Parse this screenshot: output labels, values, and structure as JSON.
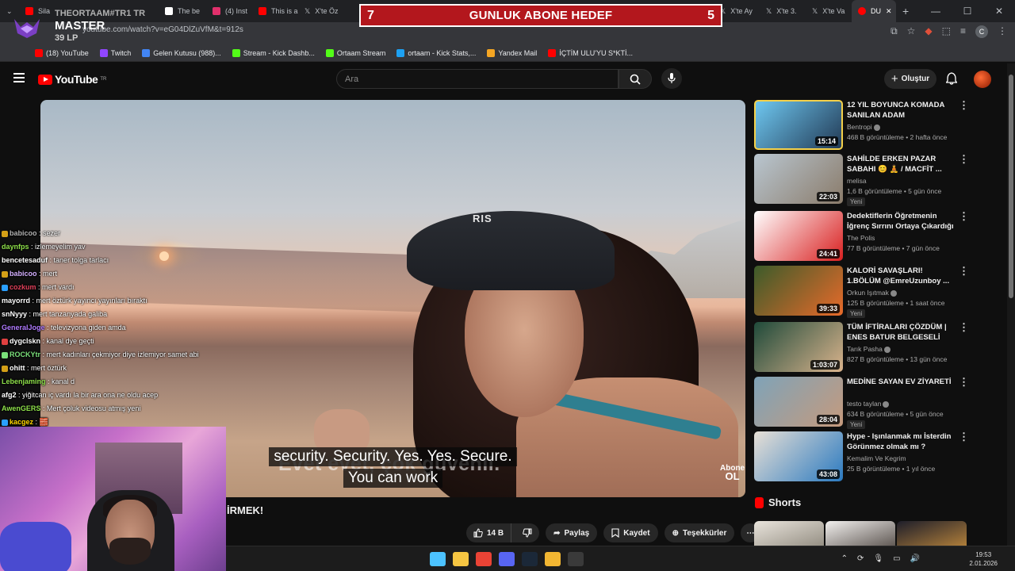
{
  "browser": {
    "tabs": [
      {
        "label": "Sila",
        "color": "#ff0000"
      },
      {
        "label": "THEORTAAM#TR1 TR",
        "color": "#9146ff"
      },
      {
        "label": "The be",
        "color": "#ffffff"
      },
      {
        "label": "(4) Inst",
        "color": "#e1306c"
      },
      {
        "label": "This is a",
        "color": "#ff0000"
      },
      {
        "label": "X'te Öz",
        "color": "#ffffff"
      },
      {
        "label": "X'te Ay",
        "color": "#ffffff"
      },
      {
        "label": "X'te 3.",
        "color": "#ffffff"
      },
      {
        "label": "X'te Va",
        "color": "#ffffff"
      },
      {
        "label": "DU",
        "color": "#ff0000"
      }
    ],
    "url": "youtube.com/watch?v=eG04DlZuVfM&t=912s",
    "profile_letter": "C",
    "bookmarks": [
      {
        "label": "(18) YouTube",
        "color": "#ff0000"
      },
      {
        "label": "Twitch",
        "color": "#9146ff"
      },
      {
        "label": "Gelen Kutusu (988)...",
        "color": "#4285f4"
      },
      {
        "label": "Stream - Kick Dashb...",
        "color": "#53fc18"
      },
      {
        "label": "Ortaam Stream",
        "color": "#53fc18"
      },
      {
        "label": "ortaam - Kick Stats,...",
        "color": "#1da1f2"
      },
      {
        "label": "Yandex Mail",
        "color": "#f5a623"
      },
      {
        "label": "İÇTİM ULU'YU S*KTİ...",
        "color": "#ff0000"
      }
    ]
  },
  "overlay": {
    "goal_left": "7",
    "goal_title": "GUNLUK ABONE HEDEF",
    "goal_right": "5",
    "rank_name": "THEORTAAM#TR1 TR",
    "rank_title": "MASTER",
    "rank_lp": "39 LP"
  },
  "youtube": {
    "logo_text": "YouTube",
    "logo_country": "TR",
    "search_placeholder": "Ara",
    "create_label": "Oluştur",
    "video": {
      "burned_subtitle": "Evet evet, çok güvenli.",
      "caption_line1": "security. Security. Yes. Yes. Secure.",
      "caption_line2": "You can work",
      "abone_top": "Abone",
      "abone_bottom": "OL",
      "title_fragment": "İRMEK!"
    },
    "actions": {
      "likes": "14 B",
      "share": "Paylaş",
      "save": "Kaydet",
      "thanks": "Teşekkürler"
    },
    "recommendations": [
      {
        "title": "12 YIL BOYUNCA KOMADA SANILAN ADAM",
        "channel": "Bentropi",
        "verified": true,
        "meta": "468 B görüntüleme • 2 hafta önce",
        "duration": "15:14",
        "badge": "",
        "colors": [
          "#6ec7f0",
          "#223a55"
        ]
      },
      {
        "title": "SAHİLDE ERKEN PAZAR SABAHI 😊 🧘 / MACFİT ...",
        "channel": "melisa",
        "verified": false,
        "meta": "1,6 B görüntüleme • 5 gün önce",
        "duration": "22:03",
        "badge": "Yeni",
        "colors": [
          "#b9c6d0",
          "#8a7b6a"
        ]
      },
      {
        "title": "Dedektiflerin Öğretmenin İğrenç Sırrını Ortaya Çıkardığı An",
        "channel": "The Polis",
        "verified": false,
        "meta": "77 B görüntüleme • 7 gün önce",
        "duration": "24:41",
        "badge": "",
        "colors": [
          "#ffffff",
          "#d92020"
        ]
      },
      {
        "title": "KALORİ SAVAŞLARI! 1.BÖLÜM @EmreUzunboy ...",
        "channel": "Orkun Işıtmak",
        "verified": true,
        "meta": "125 B görüntüleme • 1 saat önce",
        "duration": "39:33",
        "badge": "Yeni",
        "colors": [
          "#3b5b2a",
          "#e86a2a"
        ]
      },
      {
        "title": "TÜM İFTİRALARI ÇÖZDÜM | ENES BATUR BELGESELİ",
        "channel": "Tarık Pasha",
        "verified": true,
        "meta": "827 B görüntüleme • 13 gün önce",
        "duration": "1:03:07",
        "badge": "",
        "colors": [
          "#1f4a3a",
          "#d9b38c"
        ]
      },
      {
        "title": "MEDİNE SAYAN EV ZİYARETİ",
        "channel": "testo taylan",
        "verified": true,
        "meta": "634 B görüntüleme • 5 gün önce",
        "duration": "28:04",
        "badge": "Yeni",
        "colors": [
          "#7fa3b8",
          "#c59a7d"
        ]
      },
      {
        "title": "Hype - Işınlanmak mı İsterdin Görünmez olmak mı ? w/Same...",
        "channel": "Kemalim Ve Kegrim",
        "verified": false,
        "meta": "25 B görüntüleme • 1 yıl önce",
        "duration": "43:08",
        "badge": "",
        "colors": [
          "#e8e0d6",
          "#2b7ac0"
        ]
      }
    ],
    "shorts_label": "Shorts"
  },
  "chat": [
    {
      "user": "babicoo",
      "msg": "sezer",
      "color": "#b0b0b0",
      "badge": "#d4a017"
    },
    {
      "user": "daynfps",
      "msg": "izlemeyelim yav",
      "color": "#8ee04a",
      "badge": ""
    },
    {
      "user": "bencetesaduf",
      "msg": "taner tolga tarlacı",
      "color": "#ffffff",
      "badge": ""
    },
    {
      "user": "babicoo",
      "msg": "mert",
      "color": "#d4b0ff",
      "badge": "#d4a017"
    },
    {
      "user": "cozkum",
      "msg": "mert vardı",
      "color": "#e0405a",
      "badge": "#2aa0ff"
    },
    {
      "user": "mayorrd",
      "msg": "mert öztürk yayıncı yayınları bıraktı",
      "color": "#ffffff",
      "badge": ""
    },
    {
      "user": "snNyyy",
      "msg": "mert tanzanyada galiba",
      "color": "#ffffff",
      "badge": ""
    },
    {
      "user": "GeneralJoge",
      "msg": "televizyona giden amda",
      "color": "#b07bff",
      "badge": ""
    },
    {
      "user": "dygclskn",
      "msg": "kanal dye geçti",
      "color": "#ffffff",
      "badge": "#e04040"
    },
    {
      "user": "ROCKYtr",
      "msg": "mert kadınları çekmiyor diye izlemiyor samet abi",
      "color": "#7be07b",
      "badge": "#7be07b"
    },
    {
      "user": "ohitt",
      "msg": "mert öztürk",
      "color": "#ffffff",
      "badge": "#d4a017"
    },
    {
      "user": "Lebenjaming",
      "msg": "kanal d",
      "color": "#8ee04a",
      "badge": ""
    },
    {
      "user": "afg2",
      "msg": "yiğitcan iç vardı la bir ara ona ne oldu acep",
      "color": "#ffffff",
      "badge": ""
    },
    {
      "user": "AwenGERS",
      "msg": "Mert çoluk videosu atmış yeni",
      "color": "#8ee04a",
      "badge": ""
    },
    {
      "user": "kacgez",
      "msg": "🧱",
      "color": "#ffd700",
      "badge": "#2aa0ff"
    }
  ],
  "taskbar": {
    "time": "19:53",
    "date": "2.01.2026",
    "icons": [
      {
        "name": "windows-start-icon",
        "color": "#4cc2ff"
      },
      {
        "name": "file-explorer-icon",
        "color": "#f5c542"
      },
      {
        "name": "chrome-icon",
        "color": "#ea4335"
      },
      {
        "name": "discord-icon",
        "color": "#5865f2"
      },
      {
        "name": "steam-icon",
        "color": "#1b2838"
      },
      {
        "name": "app-icon",
        "color": "#f2b632"
      },
      {
        "name": "obs-icon",
        "color": "#3a3a3a"
      }
    ]
  }
}
